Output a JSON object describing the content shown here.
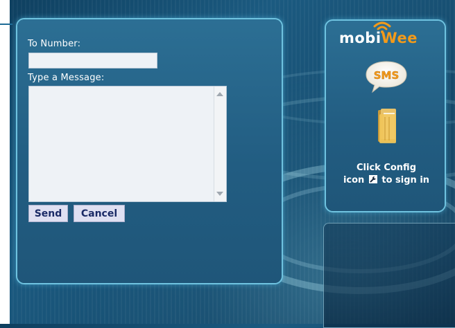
{
  "form": {
    "to_label": "To Number:",
    "to_value": "",
    "message_label": "Type a Message:",
    "message_value": "",
    "send_label": "Send",
    "cancel_label": "Cancel"
  },
  "sidebar": {
    "logo_part1": "mobi",
    "logo_part2": "Wee",
    "sms_icon_text": "SMS",
    "config_line1": "Click Config",
    "config_line2a": "icon",
    "config_line2b": "to sign in"
  },
  "colors": {
    "background": "#1b5a80",
    "panel": "#2c6f94",
    "panel_glow": "#6fc3e0",
    "button_bg": "#dfe0f2",
    "button_text": "#1a2a66",
    "logo_accent": "#f39a1a"
  },
  "icons": [
    "wifi-icon",
    "sms-bubble-icon",
    "folder-icon",
    "wrench-icon",
    "scroll-up-icon",
    "scroll-down-icon"
  ]
}
